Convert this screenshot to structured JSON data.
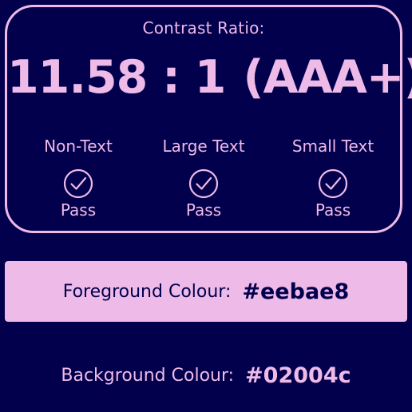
{
  "colors": {
    "background": "#02004c",
    "foreground": "#eebae8"
  },
  "ratio": {
    "caption": "Contrast Ratio:",
    "value": "11.58 : 1",
    "grade": "(AAA+)"
  },
  "checks": [
    {
      "label": "Non-Text",
      "icon": "check-circle-icon",
      "result": "Pass"
    },
    {
      "label": "Large Text",
      "icon": "check-circle-icon",
      "result": "Pass"
    },
    {
      "label": "Small Text",
      "icon": "check-circle-icon",
      "result": "Pass"
    }
  ],
  "foreground": {
    "label": "Foreground Colour:",
    "value": "#eebae8"
  },
  "background": {
    "label": "Background Colour:",
    "value": "#02004c"
  }
}
